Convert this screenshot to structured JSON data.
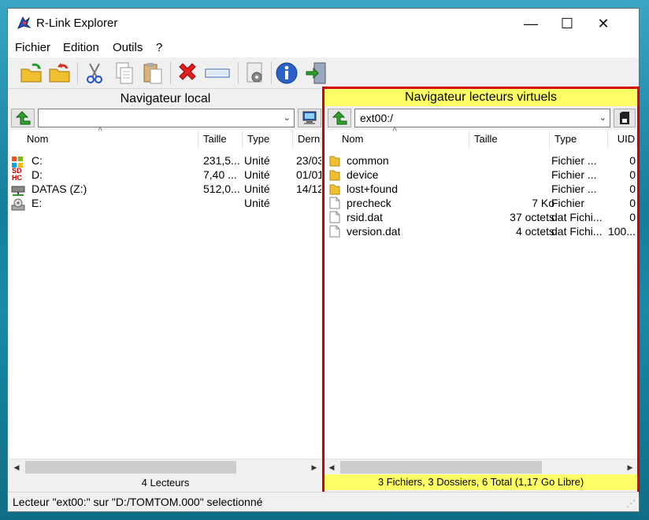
{
  "window": {
    "title": "R-Link Explorer",
    "minimize": "—",
    "maximize": "☐",
    "close": "✕"
  },
  "menu": [
    "Fichier",
    "Edition",
    "Outils",
    "?"
  ],
  "local": {
    "title": "Navigateur local",
    "path": "",
    "columns": [
      "Nom",
      "Taille",
      "Type",
      "Derniè"
    ],
    "rows": [
      {
        "name": "C:",
        "size": "231,5...",
        "type": "Unité",
        "date": "23/03"
      },
      {
        "name": "D:",
        "size": "7,40 ...",
        "type": "Unité",
        "date": "01/01"
      },
      {
        "name": "DATAS (Z:)",
        "size": "512,0...",
        "type": "Unité",
        "date": "14/12"
      },
      {
        "name": "E:",
        "size": "",
        "type": "Unité",
        "date": ""
      }
    ],
    "status": "4 Lecteurs"
  },
  "virtual": {
    "title": "Navigateur lecteurs virtuels",
    "path": "ext00:/",
    "columns": [
      "Nom",
      "Taille",
      "Type",
      "UID"
    ],
    "rows": [
      {
        "name": "common",
        "size": "",
        "type": "Fichier ...",
        "uid": "0",
        "kind": "folder"
      },
      {
        "name": "device",
        "size": "",
        "type": "Fichier ...",
        "uid": "0",
        "kind": "folder"
      },
      {
        "name": "lost+found",
        "size": "",
        "type": "Fichier ...",
        "uid": "0",
        "kind": "folder"
      },
      {
        "name": "precheck",
        "size": "7 Ko",
        "type": "Fichier",
        "uid": "0",
        "kind": "file"
      },
      {
        "name": "rsid.dat",
        "size": "37 octets",
        "type": "dat Fichi...",
        "uid": "0",
        "kind": "file"
      },
      {
        "name": "version.dat",
        "size": "4 octets",
        "type": "dat Fichi...",
        "uid": "100...",
        "kind": "file"
      }
    ],
    "status": "3 Fichiers, 3 Dossiers, 6 Total (1,17 Go Libre)"
  },
  "statusbar": "Lecteur \"ext00:\" sur \"D:/TOMTOM.000\" selectionné",
  "colors": {
    "highlight": "#ffff66",
    "selection_border": "#d40000"
  }
}
